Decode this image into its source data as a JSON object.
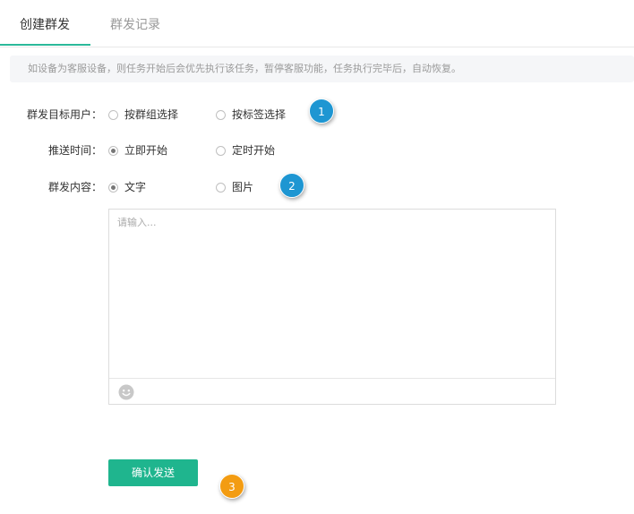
{
  "tabs": [
    {
      "label": "创建群发",
      "active": true
    },
    {
      "label": "群发记录",
      "active": false
    }
  ],
  "notice": "如设备为客服设备，则任务开始后会优先执行该任务，暂停客服功能，任务执行完毕后，自动恢复。",
  "form": {
    "target": {
      "label": "群发目标用户：",
      "options": [
        {
          "label": "按群组选择",
          "checked": false
        },
        {
          "label": "按标签选择",
          "checked": false
        }
      ]
    },
    "schedule": {
      "label": "推送时间：",
      "options": [
        {
          "label": "立即开始",
          "checked": true
        },
        {
          "label": "定时开始",
          "checked": false
        }
      ]
    },
    "content": {
      "label": "群发内容：",
      "options": [
        {
          "label": "文字",
          "checked": true
        },
        {
          "label": "图片",
          "checked": false
        }
      ]
    }
  },
  "editor": {
    "placeholder": "请输入...",
    "value": "",
    "emoji_icon": "smiley-face-icon"
  },
  "submit": {
    "label": "确认发送"
  },
  "markers": [
    "1",
    "2",
    "3"
  ],
  "colors": {
    "accent": "#2bb99a",
    "button": "#1fb58e",
    "marker_blue": "#1e96d2",
    "marker_orange": "#f39c12"
  }
}
